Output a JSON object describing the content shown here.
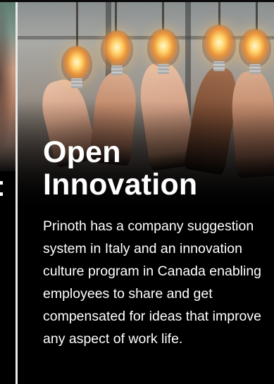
{
  "card": {
    "title_line1": "Open",
    "title_line2": "Innovation",
    "description": "Prinoth has a company suggestion system in Italy and an innovation culture program in Canada enabling employees to share and get compensated for ideas that improve any aspect of work life."
  },
  "left_card": {
    "title_fragment": ""
  },
  "colors": {
    "background": "#000000",
    "text": "#ffffff",
    "divider": "#e9e9e9",
    "bulb_glow": "#ffd36b"
  },
  "images": {
    "main_photo": "hands-holding-lightbulbs-photo",
    "left_photo": "partial-portrait-photo"
  }
}
